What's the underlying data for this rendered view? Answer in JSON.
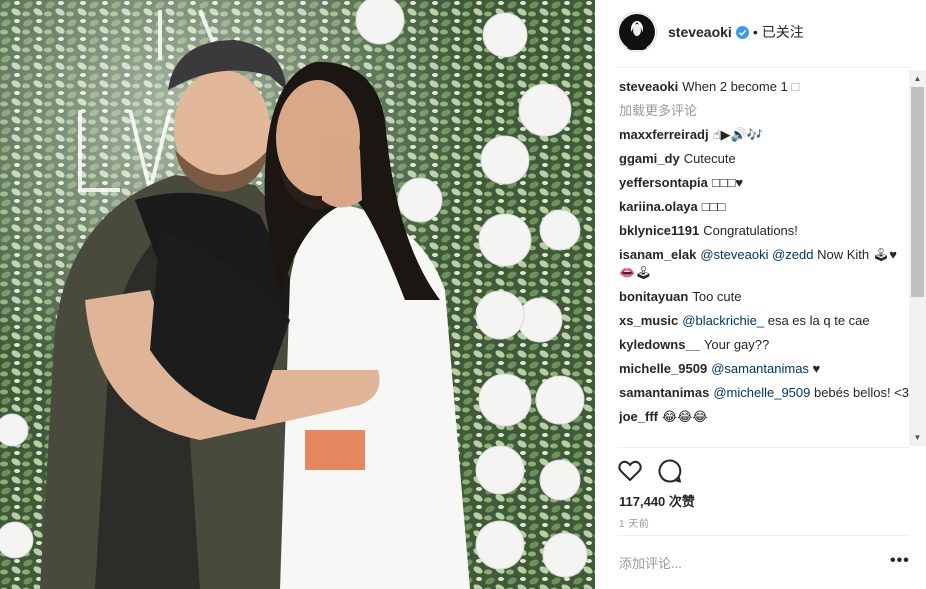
{
  "post": {
    "username": "steveaoki",
    "verified_icon": "verified-badge-icon",
    "dot": "•",
    "follow_label": "已关注",
    "caption": {
      "user": "steveaoki",
      "text": "When 2 become 1 ",
      "glyph": "□"
    },
    "load_more": "加载更多评论",
    "comments": [
      {
        "user": "maxxferreiradj",
        "text": "☝▶🔊🎶"
      },
      {
        "user": "ggami_dy",
        "text": "Cutecute"
      },
      {
        "user": "yeffersontapia",
        "text": "□□□♥"
      },
      {
        "user": "kariina.olaya",
        "text": "□□□"
      },
      {
        "user": "bklynice1191",
        "text": "Congratulations!"
      },
      {
        "user": "isanam_elak",
        "mention1": "@steveaoki",
        "mention2": "@zedd",
        "text": " Now Kith ",
        "text2": "🕹♥👄🕹"
      },
      {
        "user": "bonitayuan",
        "text": "Too cute"
      },
      {
        "user": "xs_music",
        "mention1": "@blackrichie_",
        "text": " esa es la q te cae"
      },
      {
        "user": "kyledowns__",
        "text": "Your gay??"
      },
      {
        "user": "michelle_9509",
        "mention1": "@samantanimas",
        "text": " ♥"
      },
      {
        "user": "samantanimas",
        "mention1": "@michelle_9509",
        "text": " bebés bellos! <3"
      },
      {
        "user": "joe_fff",
        "text": "😂😂😂"
      }
    ],
    "likes": "117,440 次赞",
    "time": "1 天前",
    "add_comment_placeholder": "添加评论...",
    "more_label": "•••"
  },
  "scrollbar": {
    "up": "▲",
    "down": "▼"
  },
  "colors": {
    "link": "#003569",
    "muted": "#999999",
    "verified": "#3897f0"
  }
}
